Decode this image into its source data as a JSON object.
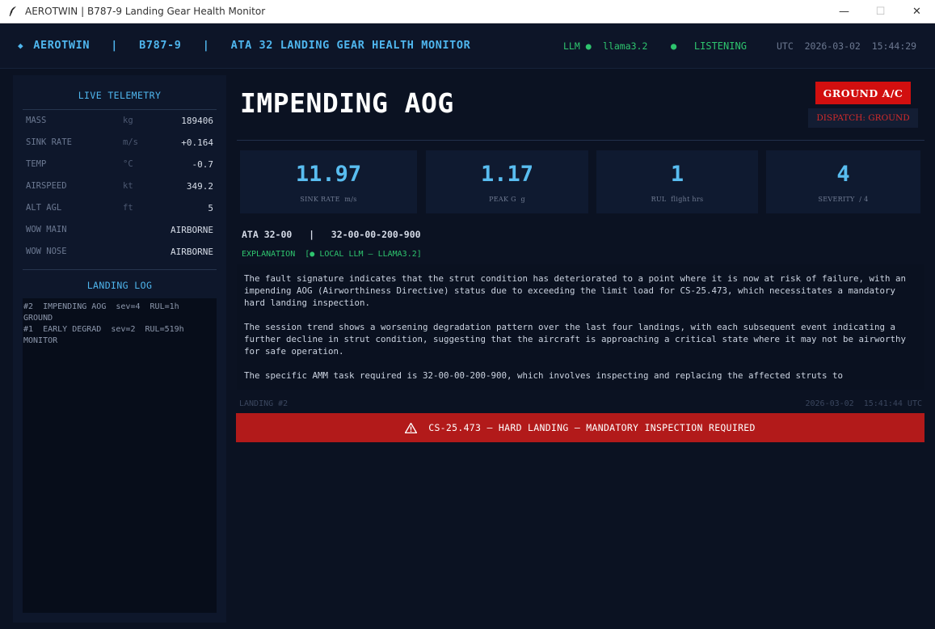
{
  "window": {
    "title": "AEROTWIN  |  B787-9 Landing Gear Health Monitor",
    "minimize": "—",
    "maximize": "☐",
    "close": "✕"
  },
  "header": {
    "brand": "AEROTWIN   |   B787-9   |   ATA 32 LANDING GEAR HEALTH MONITOR",
    "llm_label": "LLM ●",
    "llm_model": "llama3.2",
    "listening": "●   LISTENING",
    "utc": "UTC  2026-03-02  15:44:29"
  },
  "telemetry": {
    "heading": "LIVE TELEMETRY",
    "rows": [
      {
        "label": "MASS",
        "unit": "kg",
        "value": "189406"
      },
      {
        "label": "SINK RATE",
        "unit": "m/s",
        "value": "+0.164"
      },
      {
        "label": "TEMP",
        "unit": "°C",
        "value": "-0.7"
      },
      {
        "label": "AIRSPEED",
        "unit": "kt",
        "value": "349.2"
      },
      {
        "label": "ALT AGL",
        "unit": "ft",
        "value": "5"
      },
      {
        "label": "WOW MAIN",
        "unit": "",
        "value": "AIRBORNE"
      },
      {
        "label": "WOW NOSE",
        "unit": "",
        "value": "AIRBORNE"
      }
    ]
  },
  "landing_log": {
    "heading": "LANDING LOG",
    "lines": [
      "#2  IMPENDING AOG  sev=4  RUL=1h",
      "GROUND",
      "#1  EARLY DEGRAD  sev=2  RUL=519h",
      "MONITOR"
    ]
  },
  "status": {
    "title": "IMPENDING AOG",
    "action_button": "GROUND A/C",
    "dispatch": "DISPATCH: GROUND"
  },
  "metrics": [
    {
      "value": "11.97",
      "label": "SINK RATE  m/s"
    },
    {
      "value": "1.17",
      "label": "PEAK G  g"
    },
    {
      "value": "1",
      "label": "RUL  flight hrs"
    },
    {
      "value": "4",
      "label": "SEVERITY  / 4"
    }
  ],
  "ata": "ATA 32-00   |   32-00-00-200-900",
  "explanation": {
    "label": "EXPLANATION  [● LOCAL LLM — LLAMA3.2]",
    "paragraphs": [
      "The fault signature indicates that the strut condition has deteriorated to a point where it is now at risk of failure, with an impending AOG (Airworthiness Directive) status due to exceeding the limit load for CS-25.473, which necessitates a mandatory hard landing inspection.",
      "The session trend shows a worsening degradation pattern over the last four landings, with each subsequent event indicating a further decline in strut condition, suggesting that the aircraft is approaching a critical state where it may not be airworthy for safe operation.",
      "The specific AMM task required is 32-00-00-200-900, which involves inspecting and replacing the affected struts to"
    ]
  },
  "landing": {
    "number": "LANDING #2",
    "timestamp": "2026-03-02  15:41:44 UTC"
  },
  "alert": {
    "text": "CS-25.473 — HARD LANDING — MANDATORY INSPECTION REQUIRED"
  },
  "colors": {
    "background": "#0b1222",
    "accent": "#4fb6ee",
    "ok": "#2ec46e",
    "danger": "#d20f0f",
    "alert": "#b21a1a"
  }
}
